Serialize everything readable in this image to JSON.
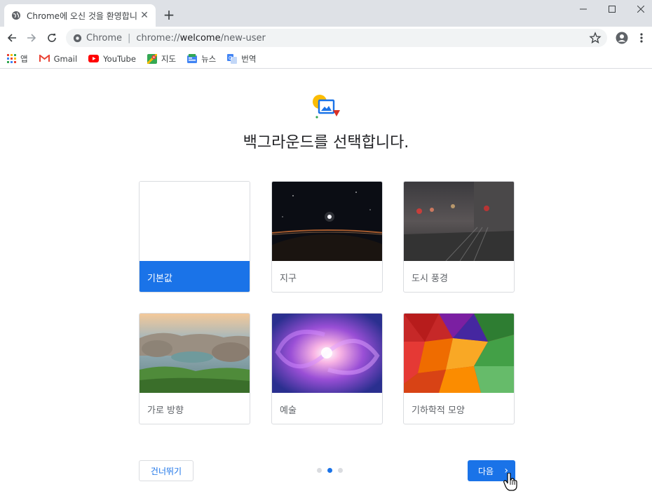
{
  "tab": {
    "title": "Chrome에 오신 것을 환영합니다",
    "close": "✕",
    "new": "+"
  },
  "window": {
    "minimize": "—",
    "maximize": "☐",
    "close": "✕"
  },
  "omnibox": {
    "site": "Chrome",
    "separator": "|",
    "url_prefix": "chrome://",
    "url_host": "welcome",
    "url_path": "/new-user"
  },
  "bookmarks": [
    {
      "label": "앱",
      "icon": "apps-grid-icon"
    },
    {
      "label": "Gmail",
      "icon": "gmail-icon"
    },
    {
      "label": "YouTube",
      "icon": "youtube-icon"
    },
    {
      "label": "지도",
      "icon": "maps-icon"
    },
    {
      "label": "뉴스",
      "icon": "news-icon"
    },
    {
      "label": "번역",
      "icon": "translate-icon"
    }
  ],
  "page": {
    "heading": "백그라운드를 선택합니다.",
    "cards": [
      {
        "label": "기본값",
        "selected": true
      },
      {
        "label": "지구",
        "selected": false
      },
      {
        "label": "도시 풍경",
        "selected": false
      },
      {
        "label": "가로 방향",
        "selected": false
      },
      {
        "label": "예술",
        "selected": false
      },
      {
        "label": "기하학적 모양",
        "selected": false
      }
    ],
    "skip_label": "건너뛰기",
    "next_label": "다음",
    "next_chevron": "›",
    "pager": {
      "total": 3,
      "current": 2
    }
  },
  "colors": {
    "accent": "#1a73e8",
    "tab_strip": "#dee1e6"
  }
}
